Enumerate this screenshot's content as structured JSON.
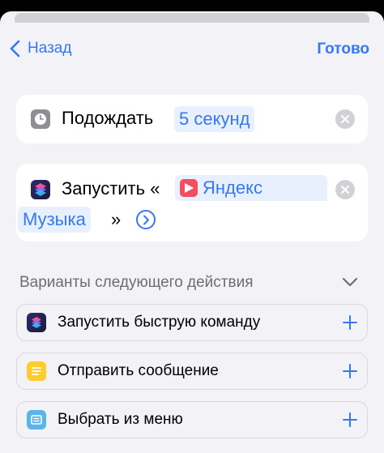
{
  "nav": {
    "back_label": "Назад",
    "done_label": "Готово"
  },
  "actions": [
    {
      "icon": "clock-icon",
      "text": "Подождать",
      "param": "5 секунд"
    },
    {
      "icon": "shortcuts-icon",
      "text_before": "Запустить «",
      "param_line1": "Яндекс",
      "param_line2": "Музыка",
      "text_after": "»",
      "param_icon": "yandex-music-icon"
    }
  ],
  "suggestions": {
    "title": "Варианты следующего действия",
    "items": [
      {
        "label": "Запустить быструю команду",
        "icon": "shortcuts-icon"
      },
      {
        "label": "Отправить сообщение",
        "icon": "message-icon"
      },
      {
        "label": "Выбрать из меню",
        "icon": "menu-icon"
      }
    ]
  },
  "colors": {
    "accent": "#3478f6",
    "background": "#f2f2f7",
    "card": "#ffffff",
    "secondary_text": "#6d6d72"
  }
}
